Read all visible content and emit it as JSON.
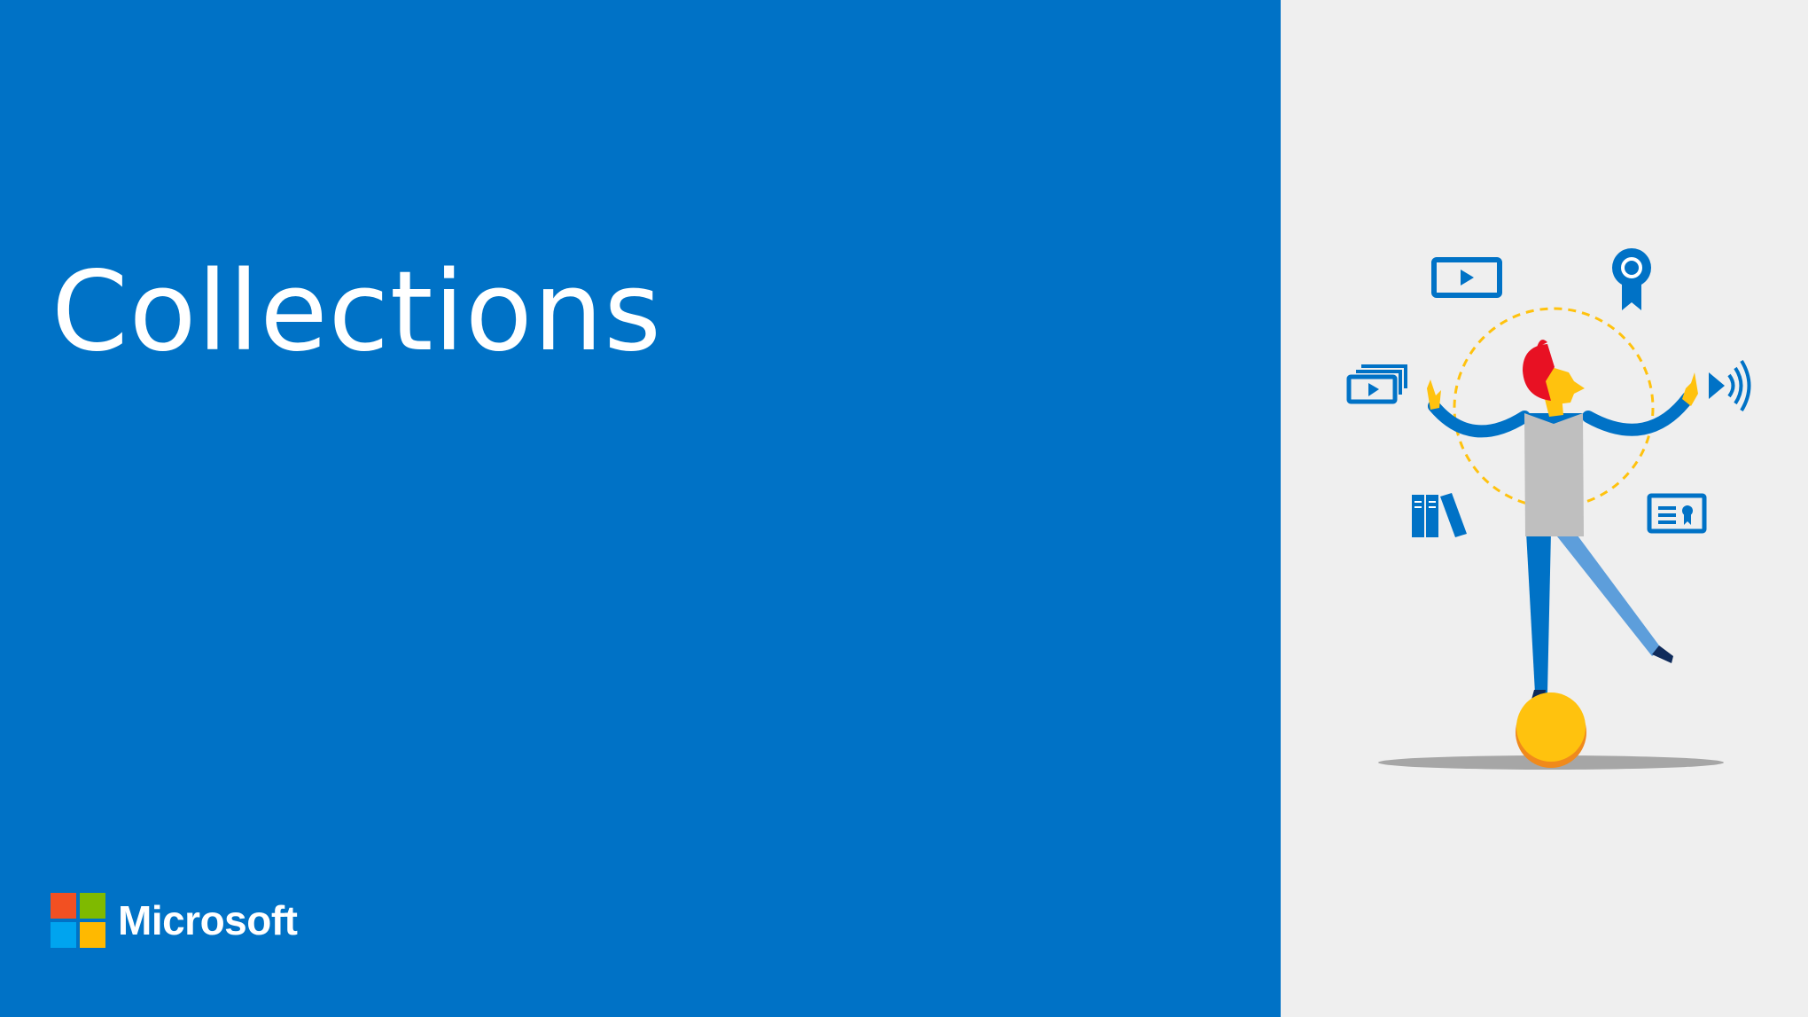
{
  "slide": {
    "title": "Collections",
    "logo": {
      "text": "Microsoft",
      "colors": [
        "#f25022",
        "#7fba00",
        "#00a4ef",
        "#ffb900"
      ]
    }
  },
  "colors": {
    "primary_blue": "#0072c6",
    "background_gray": "#efefef",
    "accent_yellow": "#ffc20e",
    "accent_red": "#e81123"
  },
  "illustration": {
    "subject": "person balancing on a ball juggling learning icons",
    "icons": [
      "video-icon",
      "award-ribbon-icon",
      "video-collection-icon",
      "audio-icon",
      "books-icon",
      "certificate-icon"
    ]
  }
}
